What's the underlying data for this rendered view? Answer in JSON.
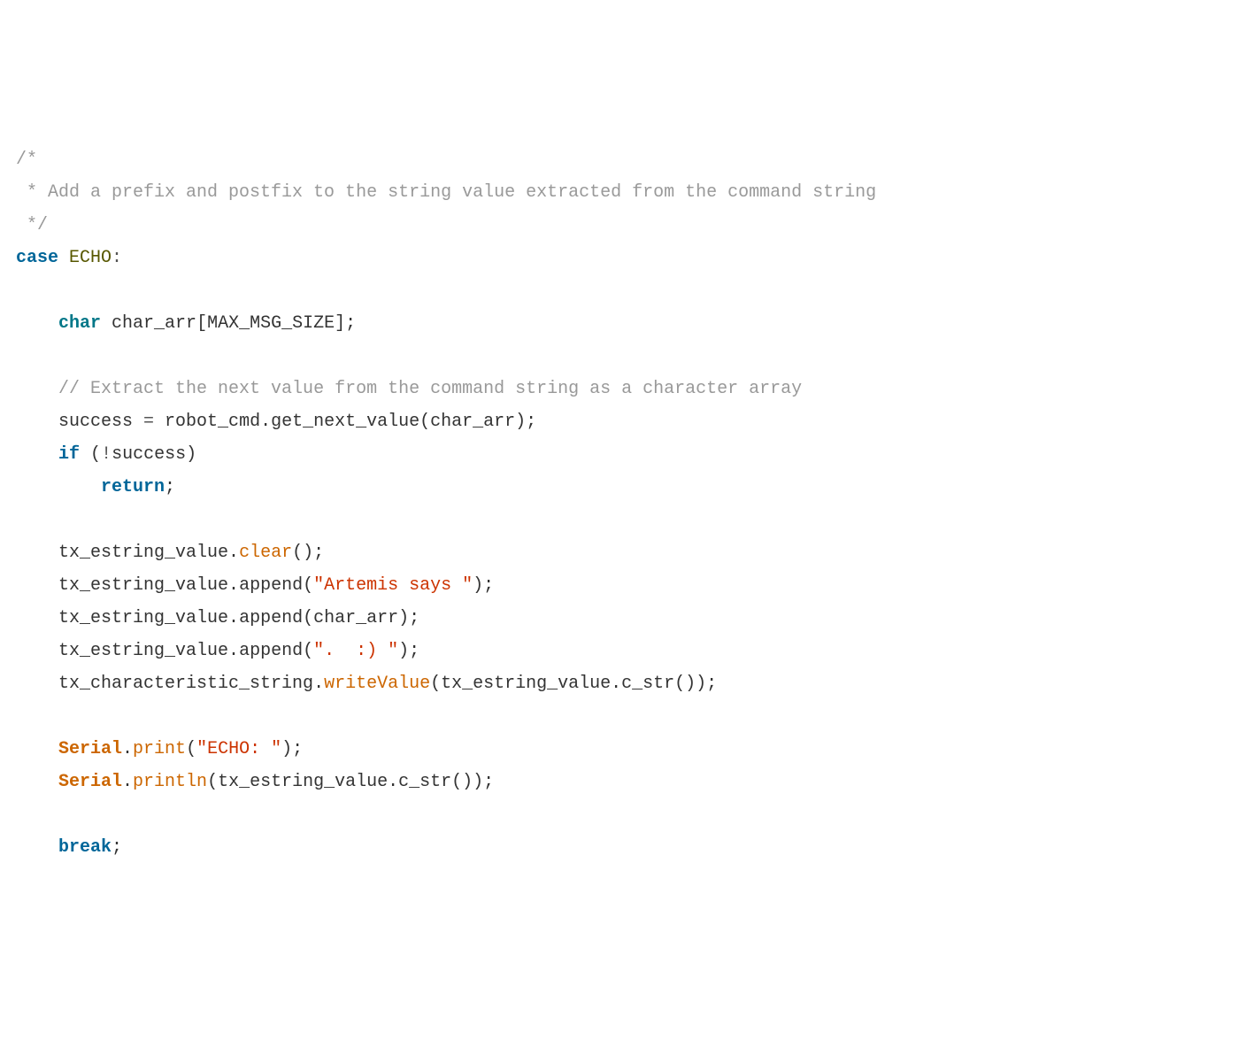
{
  "code": {
    "comment_open": "/*",
    "comment_line": " * Add a prefix and postfix to the string value extracted from the command string",
    "comment_close": " */",
    "case_kw": "case",
    "case_sp": " ",
    "case_label": "ECHO",
    "case_colon": ":",
    "blank": "",
    "indent1": "    ",
    "indent2": "        ",
    "char_kw": "char",
    "char_sp": " ",
    "char_decl": "char_arr[MAX_MSG_SIZE];",
    "comment_extract": "// Extract the next value from the command string as a character array",
    "success_lhs": "success ",
    "eq_op": "=",
    "success_rhs": " robot_cmd.get_next_value(char_arr);",
    "if_kw": "if",
    "if_sp": " ",
    "if_open": "(",
    "not_op": "!",
    "if_cond": "success",
    "if_close": ")",
    "return_kw": "return",
    "return_semi": ";",
    "txv": "tx_estring_value.",
    "clear_fn": "clear",
    "clear_tail": "();",
    "append1": "append(",
    "str_artemis": "\"Artemis says \"",
    "append_close": ");",
    "append_char_arr": "append(char_arr);",
    "append2": "append(",
    "str_smile": "\".  :) \"",
    "txc_pre": "tx_characteristic_string.",
    "writeValue_fn": "writeValue",
    "writeValue_tail": "(tx_estring_value.c_str());",
    "serial": "Serial",
    "dot": ".",
    "print_fn": "print",
    "print_open": "(",
    "str_echo": "\"ECHO: \"",
    "println_fn": "println",
    "println_args": "(tx_estring_value.c_str());",
    "break_kw": "break",
    "break_semi": ";"
  }
}
